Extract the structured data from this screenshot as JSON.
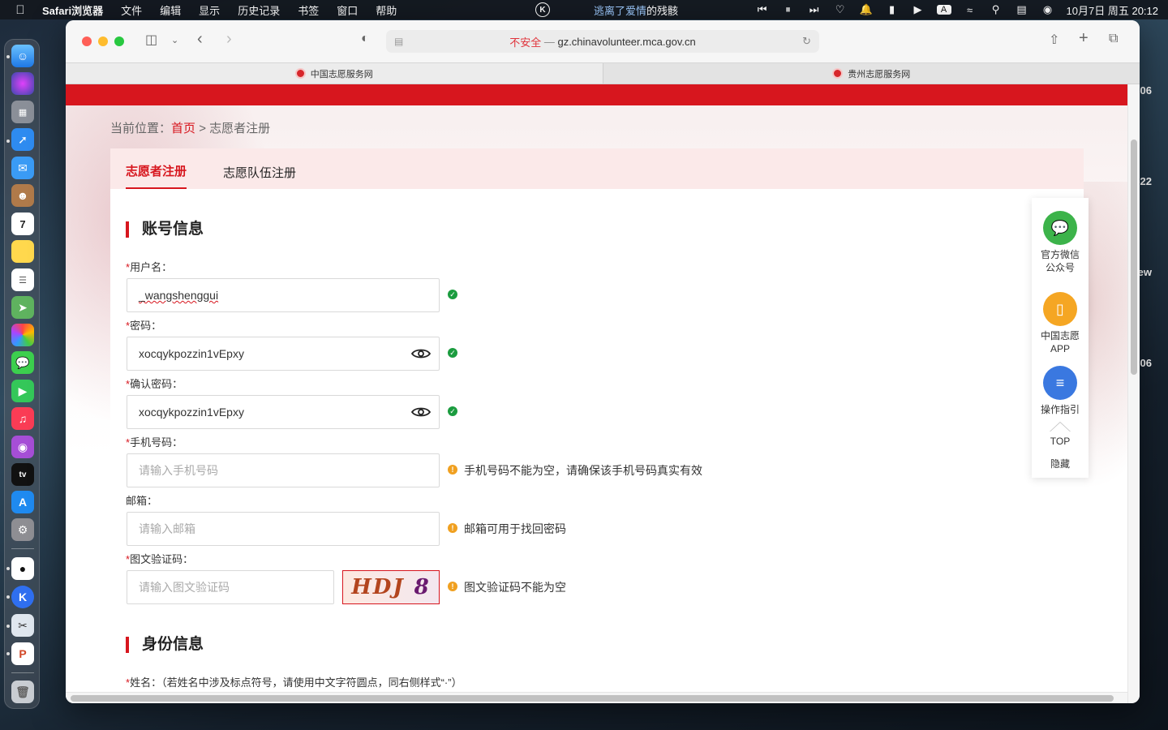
{
  "menubar": {
    "app_name": "Safari浏览器",
    "menus": [
      "文件",
      "编辑",
      "显示",
      "历史记录",
      "书签",
      "窗口",
      "帮助"
    ],
    "now_playing_prefix": "逃离了爱情",
    "now_playing_suffix": "的残骸",
    "datetime": "10月7日 周五  20:12",
    "input_method": "A"
  },
  "desktop": {
    "right_edge_text": [
      "-06",
      "-22",
      "ew",
      "-06"
    ]
  },
  "browser": {
    "url_insecure_label": "不安全",
    "url_separator": " — ",
    "url_host": "gz.chinavolunteer.mca.gov.cn",
    "tabs": [
      {
        "title": "中国志愿服务网"
      },
      {
        "title": "贵州志愿服务网"
      }
    ]
  },
  "page": {
    "breadcrumb_prefix": "当前位置：",
    "breadcrumb_home": "首页",
    "breadcrumb_sep": " > ",
    "breadcrumb_current": "志愿者注册",
    "reg_tabs": [
      "志愿者注册",
      "志愿队伍注册"
    ],
    "section_account": "账号信息",
    "section_identity": "身份信息",
    "required_mark": "*",
    "fields": {
      "username": {
        "label": "用户名：",
        "value": "_wangshenggui"
      },
      "password": {
        "label": "密码：",
        "value": "xocqykpozzin1vEpxy"
      },
      "confirm_password": {
        "label": "确认密码：",
        "value": "xocqykpozzin1vEpxy"
      },
      "phone": {
        "label": "手机号码：",
        "placeholder": "请输入手机号码",
        "hint": "手机号码不能为空，请确保该手机号码真实有效"
      },
      "email": {
        "label": "邮箱：",
        "placeholder": "请输入邮箱",
        "hint": "邮箱可用于找回密码"
      },
      "captcha": {
        "label": "图文验证码：",
        "placeholder": "请输入图文验证码",
        "hint": "图文验证码不能为空",
        "image_text_1": "HDJ",
        "image_text_2": "8"
      },
      "name": {
        "label": "姓名：",
        "note": "（若姓名中涉及标点符号，请使用中文字符圆点，同右侧样式“·”）"
      }
    },
    "float_panel": {
      "wechat": "官方微信公众号",
      "app": "中国志愿APP",
      "guide": "操作指引",
      "top": "TOP",
      "hide": "隐藏"
    }
  },
  "colors": {
    "brand_red": "#d7161e",
    "ok_green": "#1b9c3f",
    "warn_orange": "#f0a020",
    "wechat_green": "#3cb34a",
    "app_orange": "#f5a623",
    "guide_blue": "#3a78e0"
  }
}
